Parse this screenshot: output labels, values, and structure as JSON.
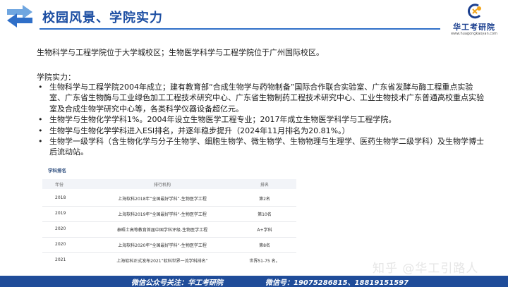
{
  "header": {
    "title": "校园风景、学院实力"
  },
  "logo": {
    "name": "华工考研院",
    "url": "www.huagongkaoyan.com"
  },
  "intro": "生物科学与工程学院位于大学城校区；生物医学科学与工程学院位于广州国际校区。",
  "strength_heading": "学院实力：",
  "bullets": [
    "生物科学与工程学院2004年成立；建有教育部“合成生物学与药物制备”国际合作联合实验室、广东省发酵与酶工程重点实验室、广东省生物酶与工业绿色加工工程技术研究中心、广东省生物制药工程技术研究中心、工业生物技术广东普通高校重点实验室及合成生物学研究中心等，各类科学仪器设备超亿元。",
    "生物学与生物化学学科1%。2004年设立生物医学工程专业；2017年成立生物医学科学与工程学院。",
    "生物学与生物化学学科进入ESI排名，并逐年稳步提升（2024年11月排名为20.81%。）",
    "生物学一级学科（含生物化学与分子生物学、细胞生物学、微生物学、生物物理与生理学、医药生物学二级学科）及生物学博士后流动站。"
  ],
  "ranking": {
    "title": "学科排名",
    "columns": [
      "年份",
      "排行机构",
      "排名"
    ],
    "rows": [
      {
        "year": "2018",
        "org": "上海软科2018年“全国最好学科”-生物医学工程",
        "rank": "第2名"
      },
      {
        "year": "2019",
        "org": "上海软科2019年“全国最好学科”-生物医学工程",
        "rank": "第10名"
      },
      {
        "year": "2020",
        "org": "泰晤士高等教育首届中国学科评级-生物医学工程",
        "rank": "A+学科"
      },
      {
        "year": "2020",
        "org": "上海软科2020年“全国最好学科”-生物医学工程",
        "rank": "第8名"
      },
      {
        "year": "2021",
        "org": "上海软科正式发布2021“软科世界一流学科排名”",
        "rank": "世界51-75 名。"
      }
    ]
  },
  "watermark": "知乎 @华工引路人",
  "footer": {
    "left": "微信公众号关注：华工考研院",
    "right": "微信号：19075286815、18819151597"
  },
  "colors": {
    "accent": "#1d4fa3",
    "footer_bg": "#1f4c99"
  }
}
